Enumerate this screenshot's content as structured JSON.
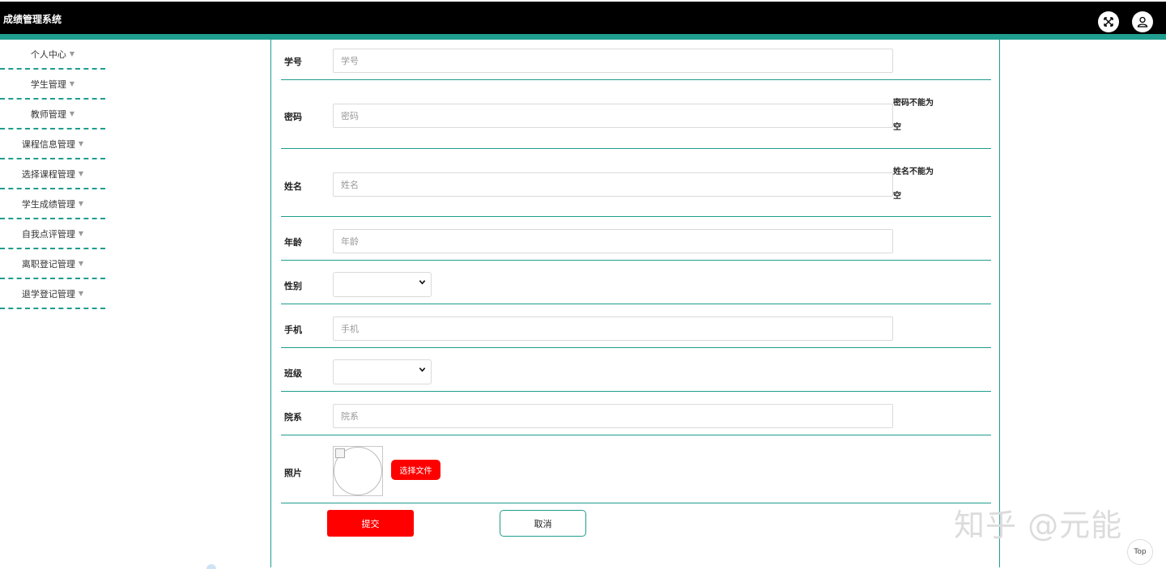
{
  "header": {
    "title": "成绩管理系统",
    "icons": [
      "fullscreen-icon",
      "user-icon"
    ]
  },
  "sidebar": {
    "items": [
      {
        "label": "个人中心"
      },
      {
        "label": "学生管理"
      },
      {
        "label": "教师管理"
      },
      {
        "label": "课程信息管理"
      },
      {
        "label": "选择课程管理"
      },
      {
        "label": "学生成绩管理"
      },
      {
        "label": "自我点评管理"
      },
      {
        "label": "离职登记管理"
      },
      {
        "label": "退学登记管理"
      }
    ]
  },
  "form": {
    "student_id": {
      "label": "学号",
      "placeholder": "学号",
      "value": ""
    },
    "password": {
      "label": "密码",
      "placeholder": "密码",
      "value": "",
      "error_line1": "密码不能为",
      "error_line2": "空"
    },
    "name": {
      "label": "姓名",
      "placeholder": "姓名",
      "value": "",
      "error_line1": "姓名不能为",
      "error_line2": "空"
    },
    "age": {
      "label": "年龄",
      "placeholder": "年龄",
      "value": ""
    },
    "gender": {
      "label": "性别",
      "selected": ""
    },
    "phone": {
      "label": "手机",
      "placeholder": "手机",
      "value": ""
    },
    "class": {
      "label": "班级",
      "selected": ""
    },
    "department": {
      "label": "院系",
      "placeholder": "院系",
      "value": ""
    },
    "photo": {
      "label": "照片",
      "choose_file_label": "选择文件"
    },
    "submit_label": "提交",
    "cancel_label": "取消"
  },
  "watermark": "知乎 @元能",
  "back_to_top_label": "Top",
  "colors": {
    "accent": "#1f9d8e",
    "primary_button": "#ff0000",
    "header_bg": "#000000"
  }
}
